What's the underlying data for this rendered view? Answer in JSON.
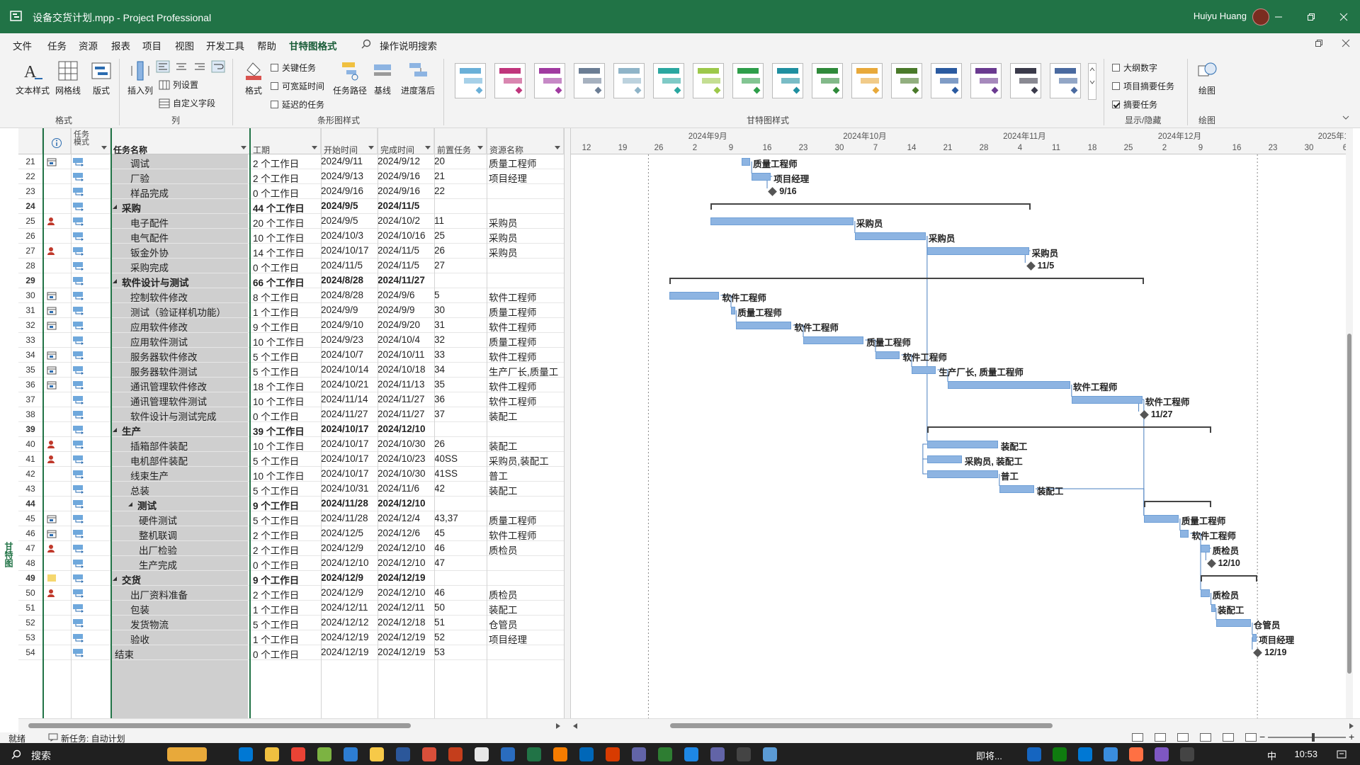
{
  "window": {
    "title": "设备交货计划.mpp  -  Project Professional",
    "user": "Huiyu Huang"
  },
  "menu": [
    "文件",
    "任务",
    "资源",
    "报表",
    "项目",
    "视图",
    "开发工具",
    "帮助",
    "甘特图格式",
    "操作说明搜索"
  ],
  "ribbon": {
    "text_style": "文本样式",
    "gridlines": "网格线",
    "layout": "版式",
    "group_format": "格式",
    "insert_column": "插入列",
    "column_settings": "列设置",
    "custom_fields": "自定义字段",
    "group_columns": "列",
    "format": "格式",
    "critical_tasks": "关键任务",
    "slack": "可宽延时间",
    "late_tasks": "延迟的任务",
    "task_path": "任务路径",
    "baseline": "基线",
    "slippage": "进度落后",
    "group_bar_styles": "条形图样式",
    "group_gantt_styles": "甘特图样式",
    "outline_number": "大纲数字",
    "project_summary": "项目摘要任务",
    "summary_tasks": "摘要任务",
    "group_show_hide": "显示/隐藏",
    "drawing": "绘图",
    "group_drawing": "绘图",
    "style_colors": [
      "#6ab0d8",
      "#c0357c",
      "#a03aa0",
      "#6b7d94",
      "#8fb4c8",
      "#2aa7a0",
      "#9cc84a",
      "#2e9e4a",
      "#1f8fa0",
      "#2f8a3a",
      "#e8a93a",
      "#4a7a2a",
      "#2a5aa0",
      "#6a3a90",
      "#3a3a4a",
      "#4a6aa0"
    ]
  },
  "columns": {
    "info": "ⓘ",
    "mode": "任务模式",
    "name": "任务名称",
    "duration": "工期",
    "start": "开始时间",
    "finish": "完成时间",
    "pred": "前置任务",
    "res": "资源名称"
  },
  "timescale": {
    "months": [
      "2024年9月",
      "2024年10月",
      "2024年11月",
      "2024年12月",
      "2025年1月"
    ],
    "days": [
      "12",
      "19",
      "26",
      "2",
      "9",
      "16",
      "23",
      "30",
      "7",
      "14",
      "21",
      "28",
      "4",
      "11",
      "18",
      "25",
      "2",
      "9",
      "16",
      "23",
      "30",
      "6"
    ]
  },
  "tasks": [
    {
      "id": "21",
      "name": "调试",
      "dur": "2 个工作日",
      "start": "2024/9/11",
      "fin": "2024/9/12",
      "pred": "20",
      "res": "质量工程师",
      "lvl": 2,
      "sum": false,
      "ind": "cal"
    },
    {
      "id": "22",
      "name": "厂验",
      "dur": "2 个工作日",
      "start": "2024/9/13",
      "fin": "2024/9/16",
      "pred": "21",
      "res": "项目经理",
      "lvl": 2,
      "sum": false,
      "ind": ""
    },
    {
      "id": "23",
      "name": "样品完成",
      "dur": "0 个工作日",
      "start": "2024/9/16",
      "fin": "2024/9/16",
      "pred": "22",
      "res": "",
      "lvl": 2,
      "sum": false,
      "ind": ""
    },
    {
      "id": "24",
      "name": "采购",
      "dur": "44 个工作日",
      "start": "2024/9/5",
      "fin": "2024/11/5",
      "pred": "",
      "res": "",
      "lvl": 1,
      "sum": true,
      "ind": ""
    },
    {
      "id": "25",
      "name": "电子配件",
      "dur": "20 个工作日",
      "start": "2024/9/5",
      "fin": "2024/10/2",
      "pred": "11",
      "res": "采购员",
      "lvl": 2,
      "sum": false,
      "ind": "person"
    },
    {
      "id": "26",
      "name": "电气配件",
      "dur": "10 个工作日",
      "start": "2024/10/3",
      "fin": "2024/10/16",
      "pred": "25",
      "res": "采购员",
      "lvl": 2,
      "sum": false,
      "ind": ""
    },
    {
      "id": "27",
      "name": "钣金外协",
      "dur": "14 个工作日",
      "start": "2024/10/17",
      "fin": "2024/11/5",
      "pred": "26",
      "res": "采购员",
      "lvl": 2,
      "sum": false,
      "ind": "person"
    },
    {
      "id": "28",
      "name": "采购完成",
      "dur": "0 个工作日",
      "start": "2024/11/5",
      "fin": "2024/11/5",
      "pred": "27",
      "res": "",
      "lvl": 2,
      "sum": false,
      "ind": ""
    },
    {
      "id": "29",
      "name": "软件设计与测试",
      "dur": "66 个工作日",
      "start": "2024/8/28",
      "fin": "2024/11/27",
      "pred": "",
      "res": "",
      "lvl": 1,
      "sum": true,
      "ind": ""
    },
    {
      "id": "30",
      "name": "控制软件修改",
      "dur": "8 个工作日",
      "start": "2024/8/28",
      "fin": "2024/9/6",
      "pred": "5",
      "res": "软件工程师",
      "lvl": 2,
      "sum": false,
      "ind": "cal"
    },
    {
      "id": "31",
      "name": "测试（验证样机功能）",
      "dur": "1 个工作日",
      "start": "2024/9/9",
      "fin": "2024/9/9",
      "pred": "30",
      "res": "质量工程师",
      "lvl": 2,
      "sum": false,
      "ind": "cal2"
    },
    {
      "id": "32",
      "name": "应用软件修改",
      "dur": "9 个工作日",
      "start": "2024/9/10",
      "fin": "2024/9/20",
      "pred": "31",
      "res": "软件工程师",
      "lvl": 2,
      "sum": false,
      "ind": "cal"
    },
    {
      "id": "33",
      "name": "应用软件测试",
      "dur": "10 个工作日",
      "start": "2024/9/23",
      "fin": "2024/10/4",
      "pred": "32",
      "res": "质量工程师",
      "lvl": 2,
      "sum": false,
      "ind": ""
    },
    {
      "id": "34",
      "name": "服务器软件修改",
      "dur": "5 个工作日",
      "start": "2024/10/7",
      "fin": "2024/10/11",
      "pred": "33",
      "res": "软件工程师",
      "lvl": 2,
      "sum": false,
      "ind": "cal"
    },
    {
      "id": "35",
      "name": "服务器软件测试",
      "dur": "5 个工作日",
      "start": "2024/10/14",
      "fin": "2024/10/18",
      "pred": "34",
      "res": "生产厂长,质量工",
      "lvl": 2,
      "sum": false,
      "ind": "cal"
    },
    {
      "id": "36",
      "name": "通讯管理软件修改",
      "dur": "18 个工作日",
      "start": "2024/10/21",
      "fin": "2024/11/13",
      "pred": "35",
      "res": "软件工程师",
      "lvl": 2,
      "sum": false,
      "ind": "cal"
    },
    {
      "id": "37",
      "name": "通讯管理软件测试",
      "dur": "10 个工作日",
      "start": "2024/11/14",
      "fin": "2024/11/27",
      "pred": "36",
      "res": "软件工程师",
      "lvl": 2,
      "sum": false,
      "ind": ""
    },
    {
      "id": "38",
      "name": "软件设计与测试完成",
      "dur": "0 个工作日",
      "start": "2024/11/27",
      "fin": "2024/11/27",
      "pred": "37",
      "res": "装配工",
      "lvl": 2,
      "sum": false,
      "ind": ""
    },
    {
      "id": "39",
      "name": "生产",
      "dur": "39 个工作日",
      "start": "2024/10/17",
      "fin": "2024/12/10",
      "pred": "",
      "res": "",
      "lvl": 1,
      "sum": true,
      "ind": ""
    },
    {
      "id": "40",
      "name": "插箱部件装配",
      "dur": "10 个工作日",
      "start": "2024/10/17",
      "fin": "2024/10/30",
      "pred": "26",
      "res": "装配工",
      "lvl": 2,
      "sum": false,
      "ind": "person"
    },
    {
      "id": "41",
      "name": "电机部件装配",
      "dur": "5 个工作日",
      "start": "2024/10/17",
      "fin": "2024/10/23",
      "pred": "40SS",
      "res": "采购员,装配工",
      "lvl": 2,
      "sum": false,
      "ind": "person"
    },
    {
      "id": "42",
      "name": "线束生产",
      "dur": "10 个工作日",
      "start": "2024/10/17",
      "fin": "2024/10/30",
      "pred": "41SS",
      "res": "普工",
      "lvl": 2,
      "sum": false,
      "ind": ""
    },
    {
      "id": "43",
      "name": "总装",
      "dur": "5 个工作日",
      "start": "2024/10/31",
      "fin": "2024/11/6",
      "pred": "42",
      "res": "装配工",
      "lvl": 2,
      "sum": false,
      "ind": ""
    },
    {
      "id": "44",
      "name": "测试",
      "dur": "9 个工作日",
      "start": "2024/11/28",
      "fin": "2024/12/10",
      "pred": "",
      "res": "",
      "lvl": 2,
      "sum": true,
      "ind": ""
    },
    {
      "id": "45",
      "name": "硬件测试",
      "dur": "5 个工作日",
      "start": "2024/11/28",
      "fin": "2024/12/4",
      "pred": "43,37",
      "res": "质量工程师",
      "lvl": 3,
      "sum": false,
      "ind": "cal"
    },
    {
      "id": "46",
      "name": "整机联调",
      "dur": "2 个工作日",
      "start": "2024/12/5",
      "fin": "2024/12/6",
      "pred": "45",
      "res": "软件工程师",
      "lvl": 3,
      "sum": false,
      "ind": "cal"
    },
    {
      "id": "47",
      "name": "出厂检验",
      "dur": "2 个工作日",
      "start": "2024/12/9",
      "fin": "2024/12/10",
      "pred": "46",
      "res": "质检员",
      "lvl": 3,
      "sum": false,
      "ind": "person"
    },
    {
      "id": "48",
      "name": "生产完成",
      "dur": "0 个工作日",
      "start": "2024/12/10",
      "fin": "2024/12/10",
      "pred": "47",
      "res": "",
      "lvl": 3,
      "sum": false,
      "ind": ""
    },
    {
      "id": "49",
      "name": "交货",
      "dur": "9 个工作日",
      "start": "2024/12/9",
      "fin": "2024/12/19",
      "pred": "",
      "res": "",
      "lvl": 1,
      "sum": true,
      "ind": "note"
    },
    {
      "id": "50",
      "name": "出厂资料准备",
      "dur": "2 个工作日",
      "start": "2024/12/9",
      "fin": "2024/12/10",
      "pred": "46",
      "res": "质检员",
      "lvl": 2,
      "sum": false,
      "ind": "person"
    },
    {
      "id": "51",
      "name": "包装",
      "dur": "1 个工作日",
      "start": "2024/12/11",
      "fin": "2024/12/11",
      "pred": "50",
      "res": "装配工",
      "lvl": 2,
      "sum": false,
      "ind": ""
    },
    {
      "id": "52",
      "name": "发货物流",
      "dur": "5 个工作日",
      "start": "2024/12/12",
      "fin": "2024/12/18",
      "pred": "51",
      "res": "仓管员",
      "lvl": 2,
      "sum": false,
      "ind": ""
    },
    {
      "id": "53",
      "name": "验收",
      "dur": "1 个工作日",
      "start": "2024/12/19",
      "fin": "2024/12/19",
      "pred": "52",
      "res": "项目经理",
      "lvl": 2,
      "sum": false,
      "ind": ""
    },
    {
      "id": "54",
      "name": "结束",
      "dur": "0 个工作日",
      "start": "2024/12/19",
      "fin": "2024/12/19",
      "pred": "53",
      "res": "",
      "lvl": 1,
      "sum": false,
      "ind": ""
    }
  ],
  "gantt": {
    "bar_labels": {
      "21": "质量工程师",
      "22": "项目经理",
      "25": "采购员",
      "26": "采购员",
      "27": "采购员",
      "30": "软件工程师",
      "31": "质量工程师",
      "32": "软件工程师",
      "33": "质量工程师",
      "34": "软件工程师",
      "35": "生产厂长, 质量工程师",
      "36": "软件工程师",
      "37": "软件工程师",
      "40": "装配工",
      "41": "采购员, 装配工",
      "42": "普工",
      "43": "装配工",
      "45": "质量工程师",
      "46": "软件工程师",
      "47": "质检员",
      "50": "质检员",
      "51": "装配工",
      "52": "仓管员",
      "53": "项目经理"
    },
    "milestone_labels": {
      "23": "9/16",
      "28": "11/5",
      "38": "11/27",
      "48": "12/10",
      "54": "12/19"
    }
  },
  "side_label": "甘特图",
  "status": {
    "ready": "就绪",
    "new_task": "新任务: 自动计划"
  },
  "taskbar": {
    "search": "搜索",
    "app_label": "即将...",
    "ime": "中",
    "time": "10:53",
    "app_colors": [
      "#e8a93a",
      "#0078d4",
      "#f0c040",
      "#ea4335",
      "#7cb342",
      "#2d7dd2",
      "#f7c948",
      "#2b579a",
      "#d94f3a",
      "#c43e1c",
      "#e7e7e7",
      "#2a6cbf",
      "#217346",
      "#f57c00",
      "#0067b8",
      "#d83b01",
      "#6264a7",
      "#2e7d32",
      "#1e88e5",
      "#6264a7",
      "#444",
      "#5b9bd5",
      "#1565c0",
      "#0f7b0f",
      "#0078d4",
      "#3a8dde",
      "#ff7043",
      "#7e57c2",
      "#444"
    ]
  }
}
